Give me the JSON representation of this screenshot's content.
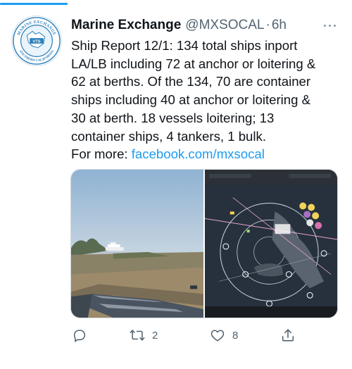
{
  "tweet": {
    "author_name": "Marine Exchange",
    "author_handle": "@MXSOCAL",
    "separator": "·",
    "timestamp": "6h",
    "text_lines": [
      "Ship Report 12/1: 134 total ships inport",
      "LA/LB including 72 at anchor or loitering &",
      "62 at berths. Of the 134, 70 are container",
      "ships including 40 at anchor or loitering &",
      "30 at berth. 18 vessels loitering; 13",
      "container ships, 4 tankers, 1 bulk."
    ],
    "more_prefix": "For more: ",
    "link_text": "facebook.com/mxsocal"
  },
  "avatar": {
    "ring_top": "MARINE EXCHANGE",
    "ring_bottom": "SOUTHERN CALIFORNIA",
    "center": "VTS"
  },
  "actions": {
    "reply_icon": "reply-icon",
    "retweet_icon": "retweet-icon",
    "retweet_count": "2",
    "like_icon": "heart-icon",
    "like_count": "8",
    "share_icon": "share-icon"
  },
  "colors": {
    "accent": "#1d9bf0",
    "text": "#0f1419",
    "secondary": "#536471"
  }
}
